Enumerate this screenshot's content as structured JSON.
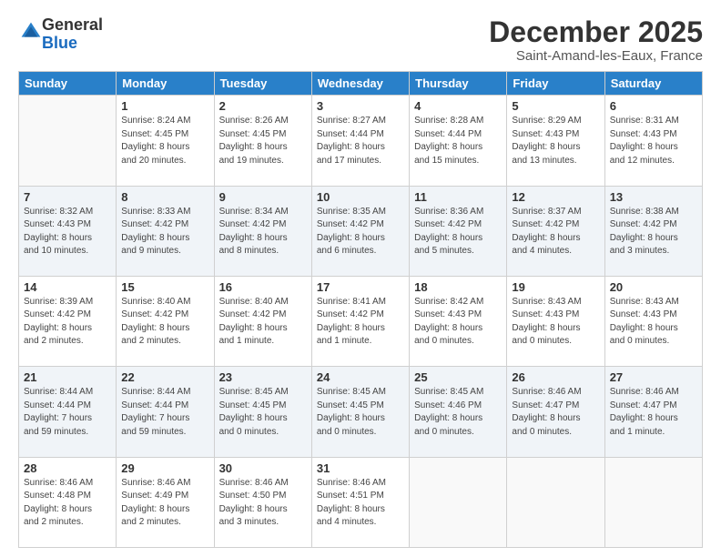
{
  "header": {
    "logo_general": "General",
    "logo_blue": "Blue",
    "month_title": "December 2025",
    "subtitle": "Saint-Amand-les-Eaux, France"
  },
  "days_of_week": [
    "Sunday",
    "Monday",
    "Tuesday",
    "Wednesday",
    "Thursday",
    "Friday",
    "Saturday"
  ],
  "weeks": [
    [
      {
        "day": "",
        "detail": ""
      },
      {
        "day": "1",
        "detail": "Sunrise: 8:24 AM\nSunset: 4:45 PM\nDaylight: 8 hours\nand 20 minutes."
      },
      {
        "day": "2",
        "detail": "Sunrise: 8:26 AM\nSunset: 4:45 PM\nDaylight: 8 hours\nand 19 minutes."
      },
      {
        "day": "3",
        "detail": "Sunrise: 8:27 AM\nSunset: 4:44 PM\nDaylight: 8 hours\nand 17 minutes."
      },
      {
        "day": "4",
        "detail": "Sunrise: 8:28 AM\nSunset: 4:44 PM\nDaylight: 8 hours\nand 15 minutes."
      },
      {
        "day": "5",
        "detail": "Sunrise: 8:29 AM\nSunset: 4:43 PM\nDaylight: 8 hours\nand 13 minutes."
      },
      {
        "day": "6",
        "detail": "Sunrise: 8:31 AM\nSunset: 4:43 PM\nDaylight: 8 hours\nand 12 minutes."
      }
    ],
    [
      {
        "day": "7",
        "detail": "Sunrise: 8:32 AM\nSunset: 4:43 PM\nDaylight: 8 hours\nand 10 minutes."
      },
      {
        "day": "8",
        "detail": "Sunrise: 8:33 AM\nSunset: 4:42 PM\nDaylight: 8 hours\nand 9 minutes."
      },
      {
        "day": "9",
        "detail": "Sunrise: 8:34 AM\nSunset: 4:42 PM\nDaylight: 8 hours\nand 8 minutes."
      },
      {
        "day": "10",
        "detail": "Sunrise: 8:35 AM\nSunset: 4:42 PM\nDaylight: 8 hours\nand 6 minutes."
      },
      {
        "day": "11",
        "detail": "Sunrise: 8:36 AM\nSunset: 4:42 PM\nDaylight: 8 hours\nand 5 minutes."
      },
      {
        "day": "12",
        "detail": "Sunrise: 8:37 AM\nSunset: 4:42 PM\nDaylight: 8 hours\nand 4 minutes."
      },
      {
        "day": "13",
        "detail": "Sunrise: 8:38 AM\nSunset: 4:42 PM\nDaylight: 8 hours\nand 3 minutes."
      }
    ],
    [
      {
        "day": "14",
        "detail": "Sunrise: 8:39 AM\nSunset: 4:42 PM\nDaylight: 8 hours\nand 2 minutes."
      },
      {
        "day": "15",
        "detail": "Sunrise: 8:40 AM\nSunset: 4:42 PM\nDaylight: 8 hours\nand 2 minutes."
      },
      {
        "day": "16",
        "detail": "Sunrise: 8:40 AM\nSunset: 4:42 PM\nDaylight: 8 hours\nand 1 minute."
      },
      {
        "day": "17",
        "detail": "Sunrise: 8:41 AM\nSunset: 4:42 PM\nDaylight: 8 hours\nand 1 minute."
      },
      {
        "day": "18",
        "detail": "Sunrise: 8:42 AM\nSunset: 4:43 PM\nDaylight: 8 hours\nand 0 minutes."
      },
      {
        "day": "19",
        "detail": "Sunrise: 8:43 AM\nSunset: 4:43 PM\nDaylight: 8 hours\nand 0 minutes."
      },
      {
        "day": "20",
        "detail": "Sunrise: 8:43 AM\nSunset: 4:43 PM\nDaylight: 8 hours\nand 0 minutes."
      }
    ],
    [
      {
        "day": "21",
        "detail": "Sunrise: 8:44 AM\nSunset: 4:44 PM\nDaylight: 7 hours\nand 59 minutes."
      },
      {
        "day": "22",
        "detail": "Sunrise: 8:44 AM\nSunset: 4:44 PM\nDaylight: 7 hours\nand 59 minutes."
      },
      {
        "day": "23",
        "detail": "Sunrise: 8:45 AM\nSunset: 4:45 PM\nDaylight: 8 hours\nand 0 minutes."
      },
      {
        "day": "24",
        "detail": "Sunrise: 8:45 AM\nSunset: 4:45 PM\nDaylight: 8 hours\nand 0 minutes."
      },
      {
        "day": "25",
        "detail": "Sunrise: 8:45 AM\nSunset: 4:46 PM\nDaylight: 8 hours\nand 0 minutes."
      },
      {
        "day": "26",
        "detail": "Sunrise: 8:46 AM\nSunset: 4:47 PM\nDaylight: 8 hours\nand 0 minutes."
      },
      {
        "day": "27",
        "detail": "Sunrise: 8:46 AM\nSunset: 4:47 PM\nDaylight: 8 hours\nand 1 minute."
      }
    ],
    [
      {
        "day": "28",
        "detail": "Sunrise: 8:46 AM\nSunset: 4:48 PM\nDaylight: 8 hours\nand 2 minutes."
      },
      {
        "day": "29",
        "detail": "Sunrise: 8:46 AM\nSunset: 4:49 PM\nDaylight: 8 hours\nand 2 minutes."
      },
      {
        "day": "30",
        "detail": "Sunrise: 8:46 AM\nSunset: 4:50 PM\nDaylight: 8 hours\nand 3 minutes."
      },
      {
        "day": "31",
        "detail": "Sunrise: 8:46 AM\nSunset: 4:51 PM\nDaylight: 8 hours\nand 4 minutes."
      },
      {
        "day": "",
        "detail": ""
      },
      {
        "day": "",
        "detail": ""
      },
      {
        "day": "",
        "detail": ""
      }
    ]
  ]
}
